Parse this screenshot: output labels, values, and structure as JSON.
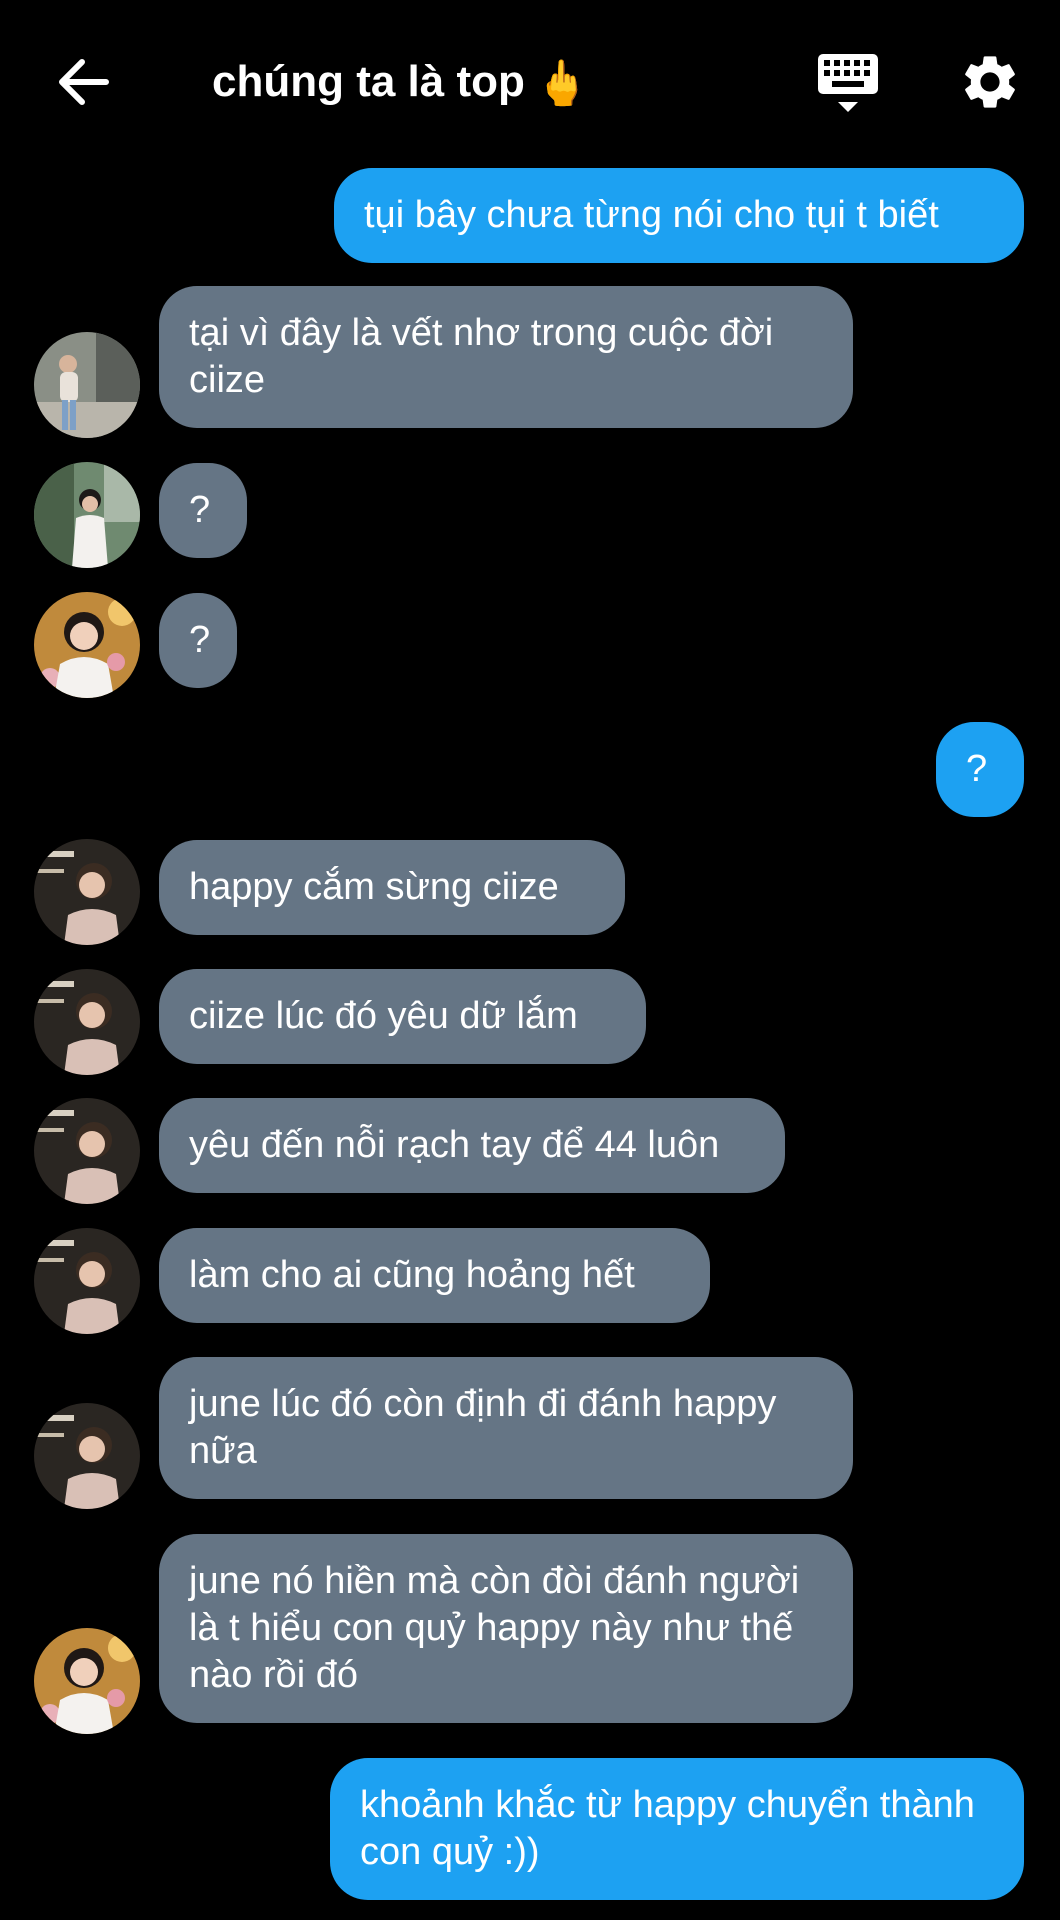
{
  "header": {
    "title": "chúng ta là top",
    "title_emoji": "🖕"
  },
  "icons": {
    "back": "arrow-left-icon",
    "keyboard": "keyboard-icon",
    "settings": "gear-icon"
  },
  "colors": {
    "background": "#000000",
    "incoming_bubble": "#657585",
    "outgoing_bubble": "#1da1f2",
    "text": "#ffffff"
  },
  "messages": [
    {
      "direction": "out",
      "text": "tụi bây chưa từng nói cho tụi t biết"
    },
    {
      "direction": "in",
      "sender_avatar": "avatar-a",
      "text": "tại vì đây là vết nhơ trong cuộc đời ciize"
    },
    {
      "direction": "in",
      "sender_avatar": "avatar-b",
      "text": "?"
    },
    {
      "direction": "in",
      "sender_avatar": "avatar-c",
      "text": "?"
    },
    {
      "direction": "out",
      "text": "?"
    },
    {
      "direction": "in",
      "sender_avatar": "avatar-d",
      "text": "happy cắm sừng ciize"
    },
    {
      "direction": "in",
      "sender_avatar": "avatar-d",
      "text": "ciize lúc đó yêu dữ lắm"
    },
    {
      "direction": "in",
      "sender_avatar": "avatar-d",
      "text": "yêu đến nỗi rạch tay để 44 luôn"
    },
    {
      "direction": "in",
      "sender_avatar": "avatar-d",
      "text": "làm cho ai cũng hoảng hết"
    },
    {
      "direction": "in",
      "sender_avatar": "avatar-d",
      "text": "june lúc đó còn định đi đánh happy nữa"
    },
    {
      "direction": "in",
      "sender_avatar": "avatar-c",
      "text": "june nó hiền mà còn đòi đánh người là t hiểu con quỷ happy này như thế nào rồi đó"
    },
    {
      "direction": "out",
      "text": "khoảnh khắc từ happy chuyển thành con quỷ :))"
    }
  ]
}
